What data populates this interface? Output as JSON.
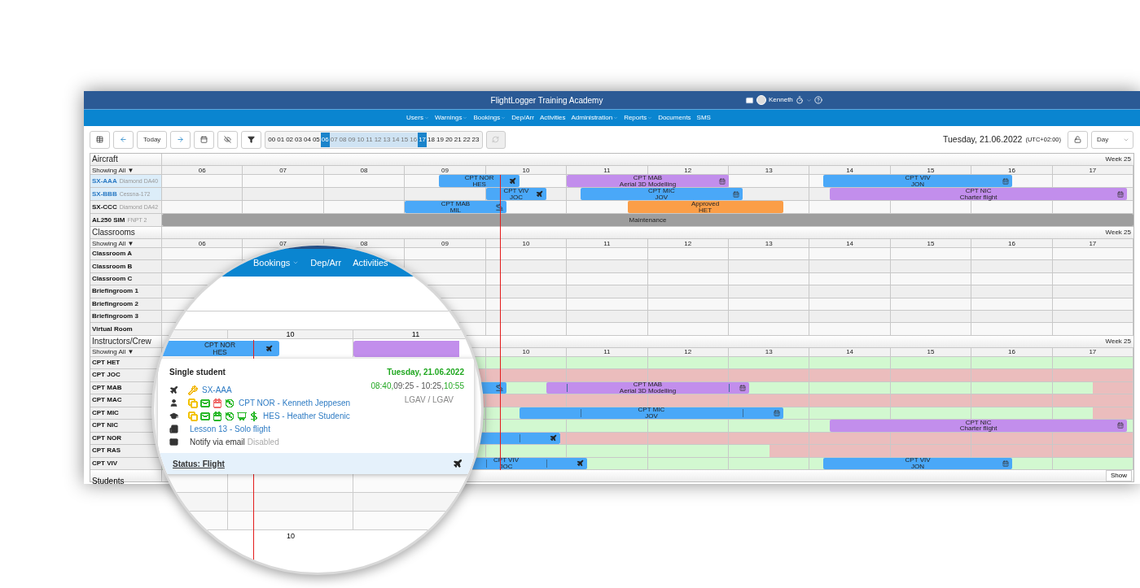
{
  "header": {
    "title": "FlightLogger Training Academy",
    "user": "Kenneth"
  },
  "nav": [
    {
      "label": "Users",
      "dropdown": true
    },
    {
      "label": "Warnings",
      "dropdown": true
    },
    {
      "label": "Bookings",
      "dropdown": true
    },
    {
      "label": "Dep/Arr",
      "dropdown": false
    },
    {
      "label": "Activities",
      "dropdown": false
    },
    {
      "label": "Administration",
      "dropdown": true
    },
    {
      "label": "Reports",
      "dropdown": true
    },
    {
      "label": "Documents",
      "dropdown": false
    },
    {
      "label": "SMS",
      "dropdown": false
    }
  ],
  "toolbar": {
    "today": "Today",
    "hours": [
      {
        "label": "00",
        "selected": false,
        "edge": false
      },
      {
        "label": "01",
        "selected": false,
        "edge": false
      },
      {
        "label": "02",
        "selected": false,
        "edge": false
      },
      {
        "label": "03",
        "selected": false,
        "edge": false
      },
      {
        "label": "04",
        "selected": false,
        "edge": false
      },
      {
        "label": "05",
        "selected": false,
        "edge": false
      },
      {
        "label": "06",
        "selected": true,
        "edge": true
      },
      {
        "label": "07",
        "selected": true,
        "edge": false
      },
      {
        "label": "08",
        "selected": true,
        "edge": false
      },
      {
        "label": "09",
        "selected": true,
        "edge": false
      },
      {
        "label": "10",
        "selected": true,
        "edge": false
      },
      {
        "label": "11",
        "selected": true,
        "edge": false
      },
      {
        "label": "12",
        "selected": true,
        "edge": false
      },
      {
        "label": "13",
        "selected": true,
        "edge": false
      },
      {
        "label": "14",
        "selected": true,
        "edge": false
      },
      {
        "label": "15",
        "selected": true,
        "edge": false
      },
      {
        "label": "16",
        "selected": true,
        "edge": false
      },
      {
        "label": "17",
        "selected": true,
        "edge": true
      },
      {
        "label": "18",
        "selected": false,
        "edge": false
      },
      {
        "label": "19",
        "selected": false,
        "edge": false
      },
      {
        "label": "20",
        "selected": false,
        "edge": false
      },
      {
        "label": "21",
        "selected": false,
        "edge": false
      },
      {
        "label": "22",
        "selected": false,
        "edge": false
      },
      {
        "label": "23",
        "selected": false,
        "edge": false
      }
    ],
    "date": "Tuesday, 21.06.2022",
    "timezone": "(UTC+02:00)",
    "view": "Day"
  },
  "sections": [
    {
      "title": "Aircraft",
      "week": "Week 25",
      "filter": "Showing All ▼",
      "hours": [
        "06",
        "07",
        "08",
        "09",
        "10",
        "11",
        "12",
        "13",
        "14",
        "15",
        "16",
        "17"
      ],
      "rows": [
        {
          "name": "SX-AAA",
          "model": "Diamond DA40",
          "highlighted": true,
          "bars": [
            {
              "kind": "airborne",
              "lines": [
                "CPT NOR",
                "HES"
              ]
            },
            {
              "kind": "activity",
              "lines": [
                "CPT MAB",
                "Aerial 3D Modelling"
              ]
            },
            {
              "kind": "booked",
              "lines": [
                "CPT VIV",
                "JON"
              ]
            }
          ]
        },
        {
          "name": "SX-BBB",
          "model": "Cessna-172",
          "highlighted": true,
          "bars": [
            {
              "kind": "airborne",
              "lines": [
                "CPT VIV",
                "JOC"
              ]
            },
            {
              "kind": "booked",
              "lines": [
                "CPT MIC",
                "JOV"
              ]
            },
            {
              "kind": "activity",
              "lines": [
                "CPT NIC",
                "Charter flight"
              ]
            }
          ]
        },
        {
          "name": "SX-CCC",
          "model": "Diamond DA42",
          "highlighted": false,
          "bars": [
            {
              "kind": "landed",
              "lines": [
                "CPT MAB",
                "MIL"
              ]
            },
            {
              "kind": "approved",
              "lines": [
                "Approved",
                "HET"
              ]
            }
          ]
        },
        {
          "name": "AL250 SIM",
          "model": "FNPT 2",
          "highlighted": false,
          "bars": [
            {
              "kind": "maintenance",
              "lines": [
                "Maintenance"
              ]
            }
          ]
        }
      ]
    },
    {
      "title": "Classrooms",
      "week": "Week 25",
      "filter": "Showing All ▼",
      "hours": [
        "06",
        "07",
        "08",
        "09",
        "10",
        "11",
        "12",
        "13",
        "14",
        "15",
        "16",
        "17"
      ],
      "rows": [
        {
          "name": "Classroom A"
        },
        {
          "name": "Classroom B"
        },
        {
          "name": "Classroom C"
        },
        {
          "name": "Briefingroom 1"
        },
        {
          "name": "Briefingroom 2"
        },
        {
          "name": "Briefingroom 3"
        },
        {
          "name": "Virtual Room"
        }
      ]
    },
    {
      "title": "Instructors/Crew",
      "week": "Week 25",
      "filter": "Showing All ▼",
      "hours": [
        "10",
        "11",
        "12",
        "13",
        "14",
        "15",
        "16",
        "17"
      ],
      "rows": [
        {
          "name": "CPT HET",
          "availability": [
            {
              "available": true
            }
          ]
        },
        {
          "name": "CPT JOC",
          "availability": [
            {
              "available": false
            }
          ]
        },
        {
          "name": "CPT MAB",
          "availability": [
            {
              "available": true
            },
            {
              "available": false
            }
          ],
          "bars": [
            {
              "kind": "landed"
            },
            {
              "kind": "activity",
              "lines": [
                "CPT MAB",
                "Aerial 3D Modelling"
              ]
            }
          ]
        },
        {
          "name": "CPT MAC",
          "availability": [
            {
              "available": false
            }
          ]
        },
        {
          "name": "CPT MIC",
          "availability": [
            {
              "available": true
            },
            {
              "available": false
            }
          ],
          "bars": [
            {
              "kind": "booked",
              "lines": [
                "CPT MIC",
                "JOV"
              ]
            }
          ]
        },
        {
          "name": "CPT NIC",
          "availability": [
            {
              "available": true
            }
          ],
          "bars": [
            {
              "kind": "activity",
              "lines": [
                "CPT NIC",
                "Charter flight"
              ]
            }
          ]
        },
        {
          "name": "CPT NOR",
          "availability": [
            {
              "available": false
            }
          ],
          "bars": [
            {
              "kind": "airborne"
            }
          ]
        },
        {
          "name": "CPT RAS",
          "availability": [
            {
              "available": true
            },
            {
              "available": false
            }
          ]
        },
        {
          "name": "CPT VIV",
          "availability": [
            {
              "available": true
            }
          ],
          "bars": [
            {
              "kind": "airborne",
              "lines": [
                "CPT VIV",
                "JOC"
              ]
            },
            {
              "kind": "booked",
              "lines": [
                "CPT VIV",
                "JON"
              ]
            }
          ]
        }
      ]
    }
  ],
  "students": {
    "title": "Students",
    "button": "Show"
  },
  "magnifier": {
    "nav": [
      {
        "label": "Bookings",
        "dropdown": true
      },
      {
        "label": "Dep/Arr",
        "dropdown": false
      },
      {
        "label": "Activities",
        "dropdown": false
      }
    ],
    "hours": [
      "10",
      "11"
    ],
    "bar": {
      "kind": "airborne",
      "lines": [
        "CPT NOR",
        "HES"
      ]
    },
    "popup": {
      "title": "Single student",
      "date": "Tuesday, 21.06.2022",
      "times": [
        {
          "text": "08:40,",
          "kind": "actual"
        },
        {
          "text": "09:25 - 10:25,",
          "kind": "planned"
        },
        {
          "text": "10:55",
          "kind": "actual"
        }
      ],
      "airports": "LGAV / LGAV",
      "lines": [
        {
          "kind": "aircraft",
          "badges": [
            {
              "color": "#f2b705"
            }
          ],
          "text": "SX-AAA"
        },
        {
          "kind": "instructor",
          "badges": [
            {
              "color": "#f2c200"
            },
            {
              "color": "#28b828"
            },
            {
              "color": "#f06a6a"
            },
            {
              "color": "#28b828"
            }
          ],
          "text": "CPT NOR - Kenneth Jeppesen"
        },
        {
          "kind": "student",
          "badges": [
            {
              "color": "#f2c200"
            },
            {
              "color": "#28b828"
            },
            {
              "color": "#28b828"
            },
            {
              "color": "#28b828"
            },
            {
              "color": "#28b828"
            },
            {
              "color": "#28b828"
            }
          ],
          "text": "HES - Heather Studenic"
        },
        {
          "kind": "lesson",
          "text": "Lesson 13 - Solo flight"
        },
        {
          "kind": "notify",
          "text": "Notify via email",
          "note": "Disabled"
        }
      ],
      "status": "Status: Flight"
    },
    "bottom_hour": "10"
  }
}
